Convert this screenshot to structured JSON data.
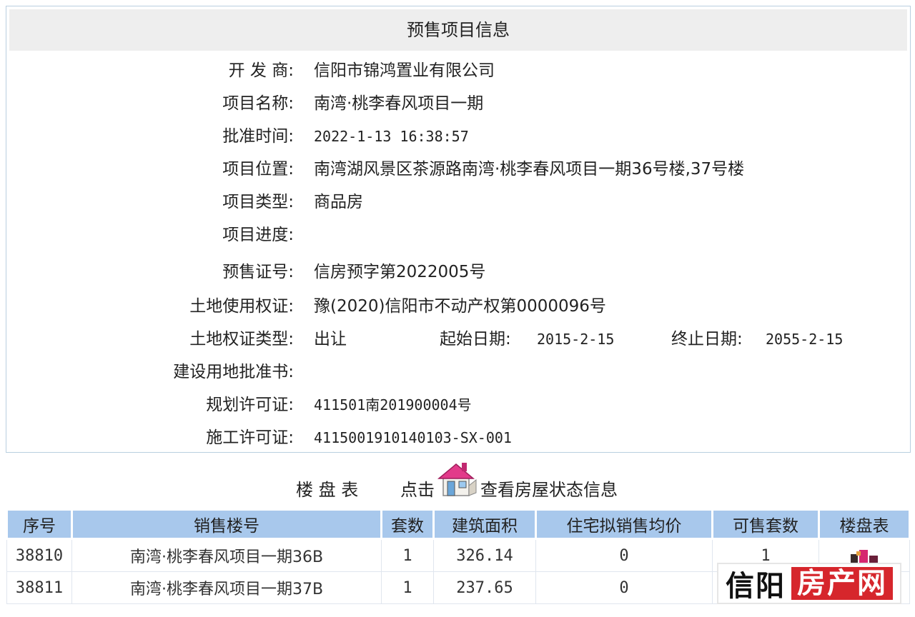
{
  "info": {
    "title": "预售项目信息",
    "rows": [
      {
        "label": "开 发 商:",
        "value": "信阳市锦鸿置业有限公司"
      },
      {
        "label": "项目名称:",
        "value": "南湾·桃李春风项目一期"
      },
      {
        "label": "批准时间:",
        "value": "2022-1-13 16:38:57"
      },
      {
        "label": "项目位置:",
        "value": "南湾湖风景区茶源路南湾·桃李春风项目一期36号楼,37号楼"
      },
      {
        "label": "项目类型:",
        "value": "商品房"
      },
      {
        "label": "项目进度:",
        "value": ""
      },
      {
        "label": "预售证号:",
        "value": "信房预字第2022005号"
      },
      {
        "label": "土地使用权证:",
        "value": "豫(2020)信阳市不动产权第0000096号"
      },
      {
        "label": "土地权证类型:",
        "value": "出让"
      },
      {
        "label": "建设用地批准书:",
        "value": ""
      },
      {
        "label": "规划许可证:",
        "value": "411501南201900004号"
      },
      {
        "label": "施工许可证:",
        "value": "4115001910140103-SX-001"
      }
    ],
    "land_extra": {
      "start_label": "起始日期:",
      "start_value": "2015-2-15",
      "end_label": "终止日期:",
      "end_value": "2055-2-15"
    }
  },
  "board": {
    "title": "楼 盘 表",
    "click_text": "点击",
    "view_text": "查看房屋状态信息",
    "icon": "house-icon"
  },
  "table": {
    "headers": [
      "序号",
      "销售楼号",
      "套数",
      "建筑面积",
      "住宅拟销售均价",
      "可售套数",
      "楼盘表"
    ],
    "rows": [
      {
        "id": "38810",
        "building": "南湾·桃李春风项目一期36B",
        "sets": "1",
        "area": "326.14",
        "price": "0",
        "available": "1"
      },
      {
        "id": "38811",
        "building": "南湾·桃李春风项目一期37B",
        "sets": "1",
        "area": "237.65",
        "price": "0",
        "available": ""
      }
    ]
  },
  "watermark": {
    "part1": "信阳",
    "part2": "房产网"
  }
}
